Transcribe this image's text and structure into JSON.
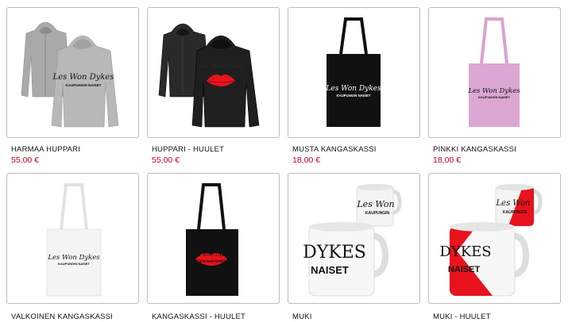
{
  "products": [
    {
      "name": "HARMAA HUPPARI",
      "price": "55,00 €",
      "print_brand": "Les Won Dykes",
      "print_sub": "KAUPUNGIN NAISET"
    },
    {
      "name": "HUPPARI - HUULET",
      "price": "55,00 €",
      "print_brand": "Les Won Dykes"
    },
    {
      "name": "MUSTA KANGASKASSI",
      "price": "18,00 €",
      "print_brand": "Les Won Dykes",
      "print_sub": "KAUPUNGIN NAISET"
    },
    {
      "name": "PINKKI KANGASKASSI",
      "price": "18,00 €",
      "print_brand": "Les Won Dykes",
      "print_sub": "KAUPUNGIN NAISET"
    },
    {
      "name": "VALKOINEN KANGASKASSI",
      "print_brand": "Les Won Dykes",
      "print_sub": "KAUPUNGIN NAISET"
    },
    {
      "name": "KANGASKASSI - HUULET",
      "print_brand": "Les Won Dykes",
      "print_sub": "KAUPUNGIN NAISET"
    },
    {
      "name": "MUKI",
      "print_brand": "Les Won",
      "print_big": "DYKES",
      "print_sub": "KAUPUNGIN",
      "print_big_sub": "NAISET"
    },
    {
      "name": "MUKI - HUULET",
      "print_brand": "Les Won",
      "print_sub": "KAUPUNGIN",
      "print_big": "DYKES",
      "print_big_sub": "NAISET"
    }
  ],
  "colors": {
    "price": "#c1001f",
    "lips": "#e8131d",
    "card_border": "#bdbdbd"
  }
}
